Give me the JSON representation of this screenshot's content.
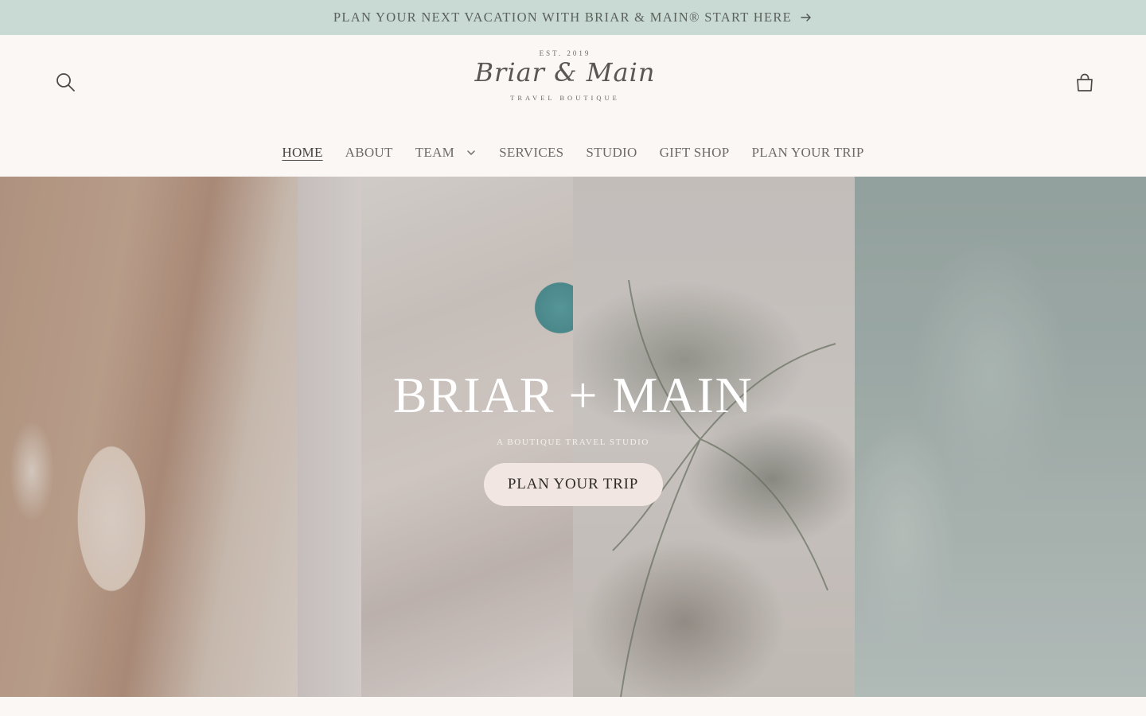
{
  "announcement": {
    "text": "PLAN YOUR NEXT VACATION WITH BRIAR & MAIN® START HERE",
    "icon": "arrow-right-icon"
  },
  "header": {
    "logo": {
      "est": "EST. 2019",
      "script": "Briar & Main",
      "subtitle": "TRAVEL BOUTIQUE"
    },
    "icons": {
      "search": "search-icon",
      "cart": "cart-icon"
    }
  },
  "nav": {
    "items": [
      {
        "label": "HOME",
        "active": true
      },
      {
        "label": "ABOUT"
      },
      {
        "label": "TEAM",
        "has_dropdown": true
      },
      {
        "label": "SERVICES"
      },
      {
        "label": "STUDIO"
      },
      {
        "label": "GIFT SHOP"
      },
      {
        "label": "PLAN YOUR TRIP"
      }
    ]
  },
  "hero": {
    "title": "BRIAR + MAIN",
    "subtitle": "A BOUTIQUE TRAVEL STUDIO",
    "cta_label": "PLAN YOUR TRIP"
  },
  "colors": {
    "announcement_bg": "#c8dad3",
    "page_bg": "#faf7f4",
    "cta_bg": "#f1e6e1",
    "text": "#5f5a57"
  }
}
